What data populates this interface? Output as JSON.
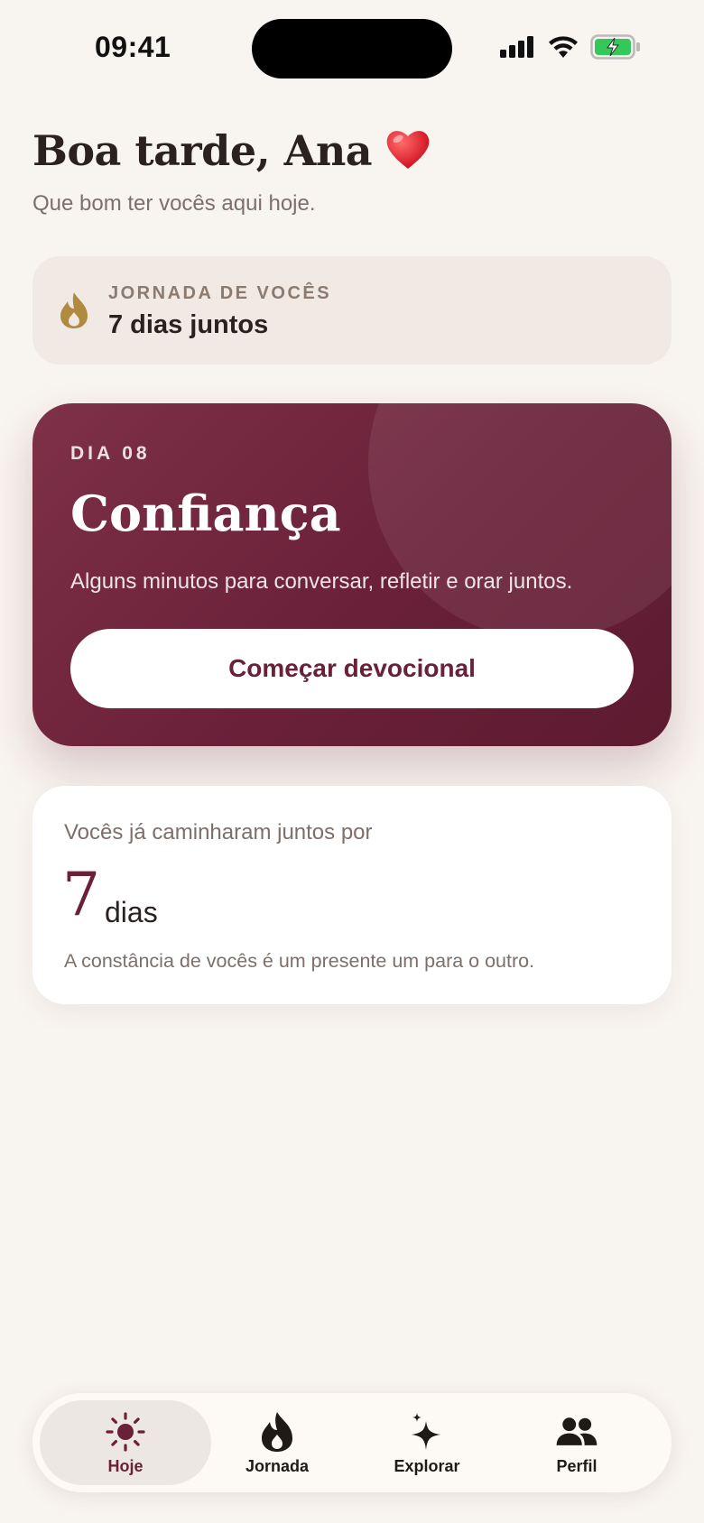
{
  "status_bar": {
    "time": "09:41"
  },
  "greeting": {
    "title": "Boa tarde, Ana",
    "emoji": "❤️",
    "subtitle": "Que bom ter vocês aqui hoje."
  },
  "streak": {
    "icon": "flame-icon",
    "label": "JORNADA DE VOCÊS",
    "value": "7 dias juntos"
  },
  "devotional": {
    "day_label": "DIA 08",
    "title": "Confiança",
    "description": "Alguns minutos para conversar, refletir e orar juntos.",
    "button_label": "Começar devocional",
    "accent_color": "#6a2039"
  },
  "days_card": {
    "intro": "Vocês já caminharam juntos por",
    "number": "7",
    "unit": "dias",
    "note": "A constância de vocês é um presente um para o outro."
  },
  "tab_bar": {
    "tabs": [
      {
        "label": "Hoje",
        "icon": "sun-icon",
        "active": true
      },
      {
        "label": "Jornada",
        "icon": "flame-icon",
        "active": false
      },
      {
        "label": "Explorar",
        "icon": "sparkles-icon",
        "active": false
      },
      {
        "label": "Perfil",
        "icon": "people-icon",
        "active": false
      }
    ]
  },
  "colors": {
    "background": "#f8f4f0",
    "primary": "#6a2039",
    "flame": "#b08a3e",
    "battery": "#34c759"
  }
}
